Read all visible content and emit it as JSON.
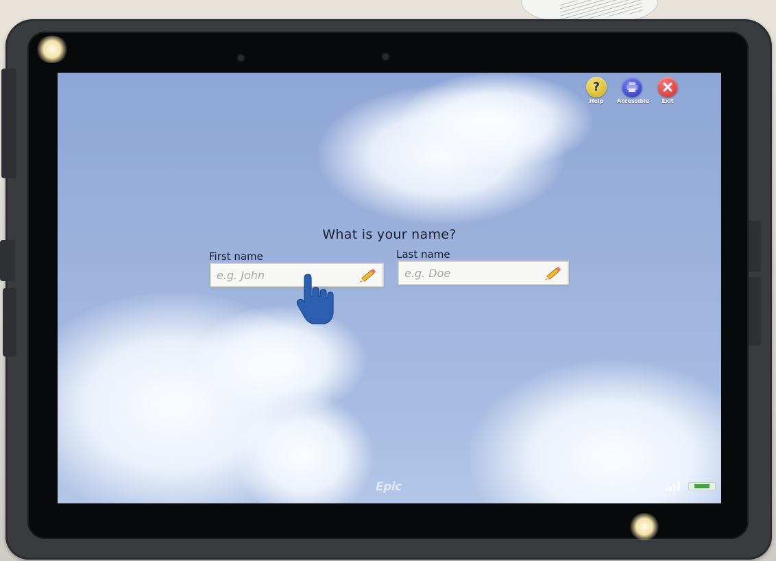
{
  "header": {
    "buttons": [
      {
        "id": "help",
        "label": "Help",
        "glyph": "?",
        "icon": "help-icon",
        "color": "#e0c63a"
      },
      {
        "id": "accessible",
        "label": "Accessible",
        "icon": "printer-icon",
        "color": "#3a45d0"
      },
      {
        "id": "exit",
        "label": "Exit",
        "icon": "close-icon",
        "color": "#d94545"
      }
    ]
  },
  "form": {
    "question": "What is your name?",
    "first_name": {
      "label": "First name",
      "placeholder": "e.g. John",
      "value": "",
      "icon": "pencil-icon"
    },
    "last_name": {
      "label": "Last name",
      "placeholder": "e.g. Doe",
      "value": "",
      "icon": "pencil-icon"
    }
  },
  "pointer": {
    "icon": "tap-hand-icon",
    "color": "#2c5fb0"
  },
  "footer": {
    "brand": "Epic",
    "status_icons": [
      "signal-icon",
      "battery-charging-icon"
    ]
  },
  "colors": {
    "sky": "#9db3dd",
    "bezel": "#08090a",
    "case": "#3a3b3e"
  }
}
